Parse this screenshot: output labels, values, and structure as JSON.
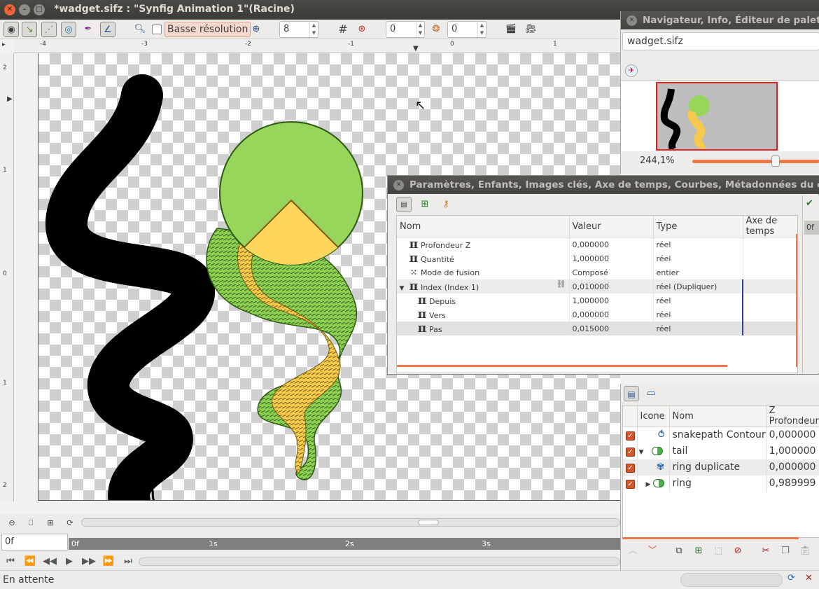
{
  "window": {
    "title": "*wadget.sifz : \"Synfig Animation 1\"(Racine)"
  },
  "toolbar": {
    "low_res_label": "Basse résolution",
    "spin1": "8",
    "spin2": "0",
    "spin3": "0"
  },
  "ruler": {
    "h_labels": [
      "-4",
      "-3",
      "-2",
      "-1",
      "0",
      "1"
    ],
    "v_labels": [
      "2",
      "1",
      "0",
      "1",
      "2"
    ]
  },
  "time": {
    "current": "0f",
    "ticks": [
      "0f",
      "1s",
      "2s",
      "3s"
    ]
  },
  "status": {
    "text": "En attente"
  },
  "nav": {
    "title": "Navigateur, Info, Éditeur de palettes",
    "file": "wadget.sifz",
    "zoom": "244,1%"
  },
  "params": {
    "title": "Paramètres, Enfants, Images clés, Axe de temps, Courbes, Métadonnées du canevas",
    "headers": [
      "Nom",
      "Valeur",
      "Type",
      "Axe de temps"
    ],
    "rows": [
      {
        "name": "Profondeur Z",
        "value": "0,000000",
        "type": "réel",
        "icon": "pi"
      },
      {
        "name": "Quantité",
        "value": "1,000000",
        "type": "réel",
        "icon": "pi"
      },
      {
        "name": "Mode de fusion",
        "value": "Composé",
        "type": "entier",
        "icon": "blend"
      },
      {
        "name": "Index (Index 1)",
        "value": "0,010000",
        "type": "réel (Dupliquer)",
        "icon": "pi"
      },
      {
        "name": "Depuis",
        "value": "1,000000",
        "type": "réel",
        "icon": "pi"
      },
      {
        "name": "Vers",
        "value": "0,000000",
        "type": "réel",
        "icon": "pi"
      },
      {
        "name": "Pas",
        "value": "0,015000",
        "type": "réel",
        "icon": "pi"
      }
    ],
    "side_tab": "0f"
  },
  "layers": {
    "headers": [
      "Icone",
      "Nom",
      "Z Profondeur"
    ],
    "rows": [
      {
        "name": "snakepath Contour",
        "z": "0,000000"
      },
      {
        "name": "tail",
        "z": "1,000000"
      },
      {
        "name": "ring duplicate",
        "z": "0,000000"
      },
      {
        "name": "ring",
        "z": "0,989999"
      }
    ]
  },
  "colors": {
    "accent": "#f07746",
    "green": "#97d65a",
    "yellow": "#ffd65c"
  }
}
